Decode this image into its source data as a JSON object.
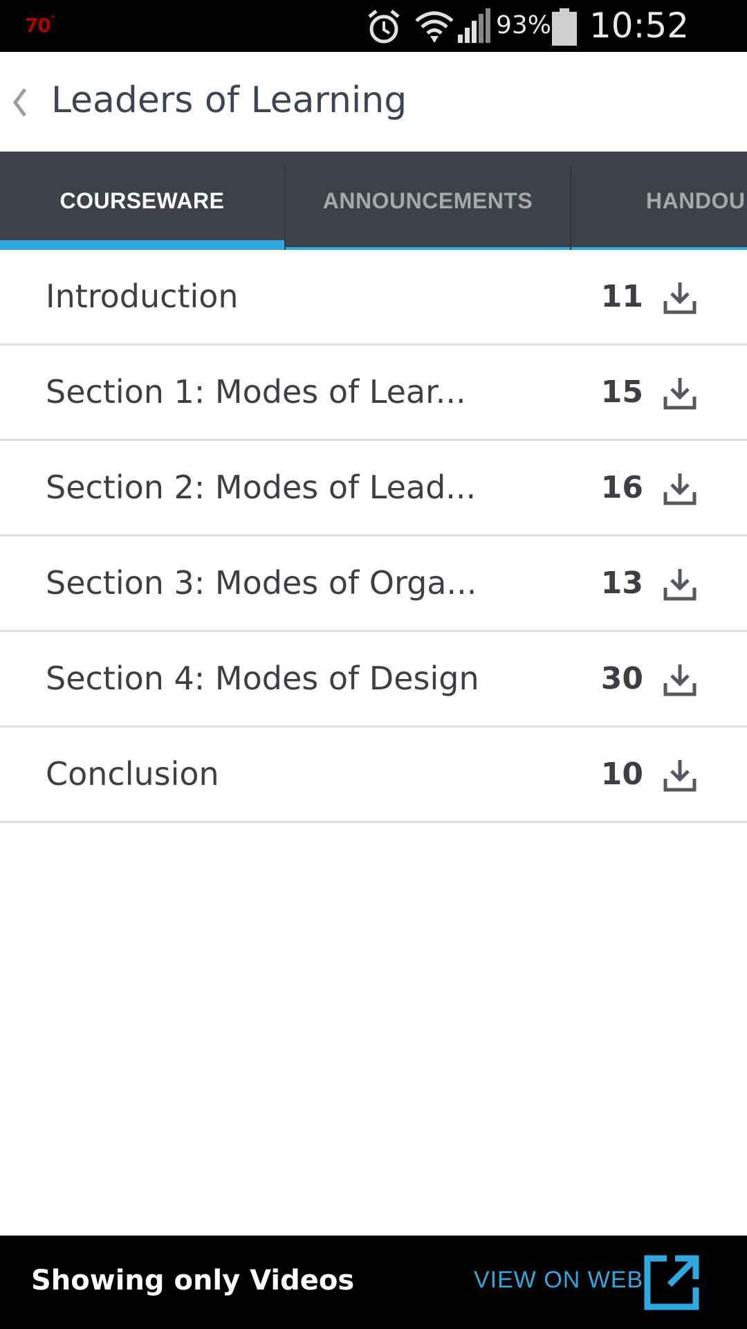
{
  "status_bar": {
    "temperature": "70",
    "battery_percent": "93%",
    "time": "10:52 AM"
  },
  "header": {
    "title": "Leaders of Learning"
  },
  "tabs": [
    {
      "label": "COURSEWARE",
      "active": true
    },
    {
      "label": "ANNOUNCEMENTS",
      "active": false
    },
    {
      "label": "HANDOU",
      "active": false
    }
  ],
  "sections": [
    {
      "title": "Introduction",
      "count": "11"
    },
    {
      "title": "Section 1: Modes of Lear...",
      "count": "15"
    },
    {
      "title": "Section 2: Modes of Lead...",
      "count": "16"
    },
    {
      "title": "Section 3: Modes of Orga...",
      "count": "13"
    },
    {
      "title": "Section 4: Modes of Design",
      "count": "30"
    },
    {
      "title": "Conclusion",
      "count": "10"
    }
  ],
  "footer": {
    "filter_label": "Showing only Videos",
    "view_on_web_label": "VIEW ON WEB"
  },
  "colors": {
    "accent": "#2fa7df",
    "tab_bar": "#3e4147",
    "status_bar": "#000000"
  }
}
